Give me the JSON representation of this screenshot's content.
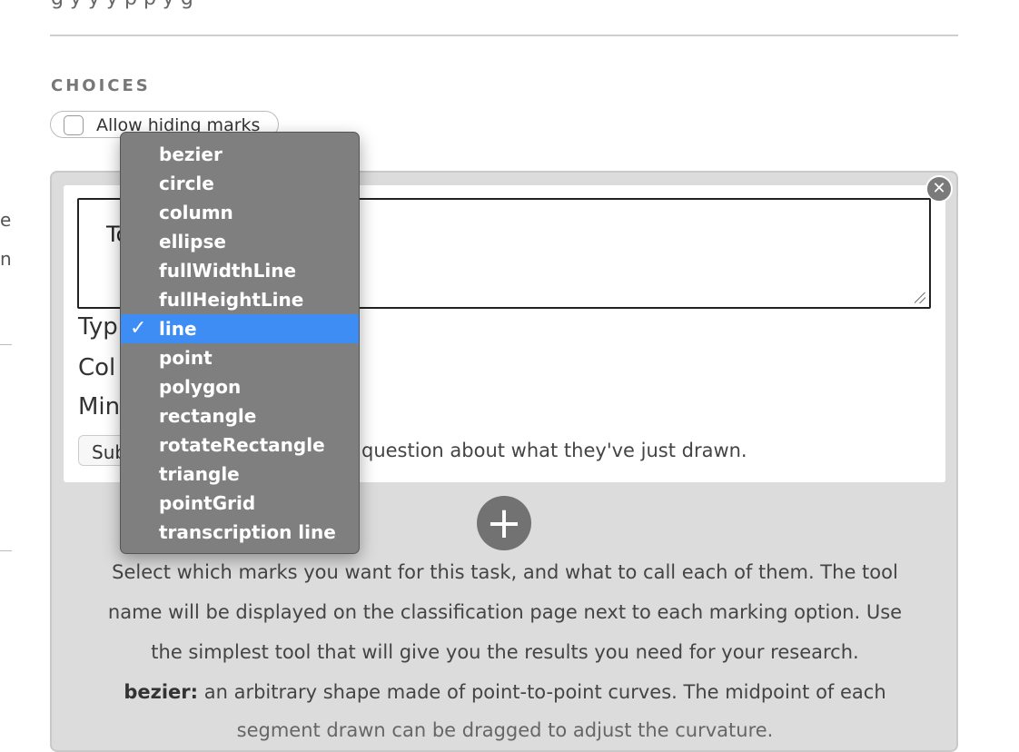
{
  "top": {
    "cut_text": "g y  y  y  p p  y g"
  },
  "left_fragments": [
    "e",
    "n"
  ],
  "choices": {
    "title": "CHOICES",
    "allow_hiding_label": "Allow hiding marks",
    "allow_hiding_checked": false
  },
  "tool": {
    "text_visible": "To",
    "type_label": "Typ",
    "color_label": "Col",
    "min_label": "Min",
    "sub_button": "Sub",
    "sub_description": "question about what they've just drawn."
  },
  "dropdown": {
    "options": [
      "bezier",
      "circle",
      "column",
      "ellipse",
      "fullWidthLine",
      "fullHeightLine",
      "line",
      "point",
      "polygon",
      "rectangle",
      "rotateRectangle",
      "triangle",
      "pointGrid",
      "transcription line"
    ],
    "selected": "line",
    "check_glyph": "✓"
  },
  "help": {
    "line1": "Select which marks you want for this task, and what to call each of them. The tool",
    "line2": "name will be displayed on the classification page next to each marking option. Use",
    "line3": "the simplest tool that will give you the results you need for your research.",
    "bezier_term": "bezier:",
    "bezier_desc": " an arbitrary shape made of point-to-point curves. The midpoint of each",
    "line5": "segment drawn can be dragged to adjust the curvature."
  },
  "icons": {
    "close": "close-icon",
    "add": "plus-icon"
  },
  "colors": {
    "selection": "#3d8df5",
    "menu_bg": "#7f7f7f",
    "panel_bg": "#dcdcdc"
  }
}
